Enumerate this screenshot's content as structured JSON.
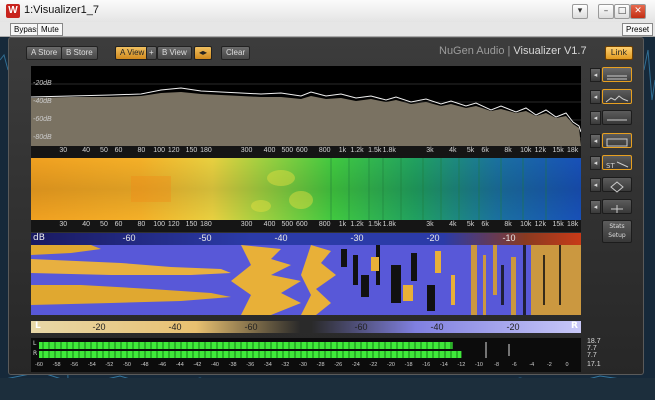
{
  "window": {
    "title": "1:Visualizer1_7",
    "app_icon_letter": "W"
  },
  "host_toolbar": {
    "bypass": "Bypass",
    "mute": "Mute",
    "preset": "Preset"
  },
  "toolbar": {
    "a_store": "A Store",
    "b_store": "B Store",
    "a_view": "A View",
    "plus": "+",
    "b_view": "B View",
    "swap": "◂▸",
    "clear": "Clear",
    "link": "Link"
  },
  "brand": {
    "company": "NuGen Audio",
    "separator": " | ",
    "product": "Visualizer V1.7"
  },
  "spectrum": {
    "db_labels": [
      "-20dB",
      "-40dB",
      "-60dB",
      "-80dB"
    ]
  },
  "freq_labels": [
    "30",
    "40",
    "50",
    "60",
    "80",
    "100",
    "120",
    "150",
    "180",
    "300",
    "400",
    "500",
    "600",
    "800",
    "1k",
    "1.2k",
    "1.5k",
    "1.8k",
    "3k",
    "4k",
    "5k",
    "6k",
    "8k",
    "10k",
    "12k",
    "15k",
    "18k"
  ],
  "freq_values": [
    30,
    40,
    50,
    60,
    80,
    100,
    120,
    150,
    180,
    300,
    400,
    500,
    600,
    800,
    1000,
    1200,
    1500,
    1800,
    3000,
    4000,
    5000,
    6000,
    8000,
    10000,
    12000,
    15000,
    18000
  ],
  "stereo_scale": {
    "unit": "dB",
    "labels": [
      "-60",
      "-50",
      "-40",
      "-30",
      "-20",
      "-10"
    ]
  },
  "balance_scale": {
    "left": "L",
    "right": "R",
    "labels": [
      "-20",
      "-40",
      "-60",
      "-60",
      "-40",
      "-20"
    ]
  },
  "meters": {
    "left_label": "L",
    "right_label": "R",
    "ticks": [
      "-60",
      "-58",
      "-56",
      "-54",
      "-52",
      "-50",
      "-48",
      "-46",
      "-44",
      "-42",
      "-40",
      "-38",
      "-36",
      "-34",
      "-32",
      "-30",
      "-28",
      "-26",
      "-24",
      "-22",
      "-20",
      "-18",
      "-16",
      "-14",
      "-12",
      "-10",
      "-8",
      "-6",
      "-4",
      "-2",
      "0"
    ],
    "values": [
      "18.7",
      "7.7",
      "7.7",
      "17.1"
    ],
    "left_level_db": -13,
    "right_level_db": -12
  },
  "side": {
    "stats_setup": "Stats\nSetup"
  },
  "colors": {
    "accent": "#e8a020",
    "meter": "#3fe83a"
  }
}
